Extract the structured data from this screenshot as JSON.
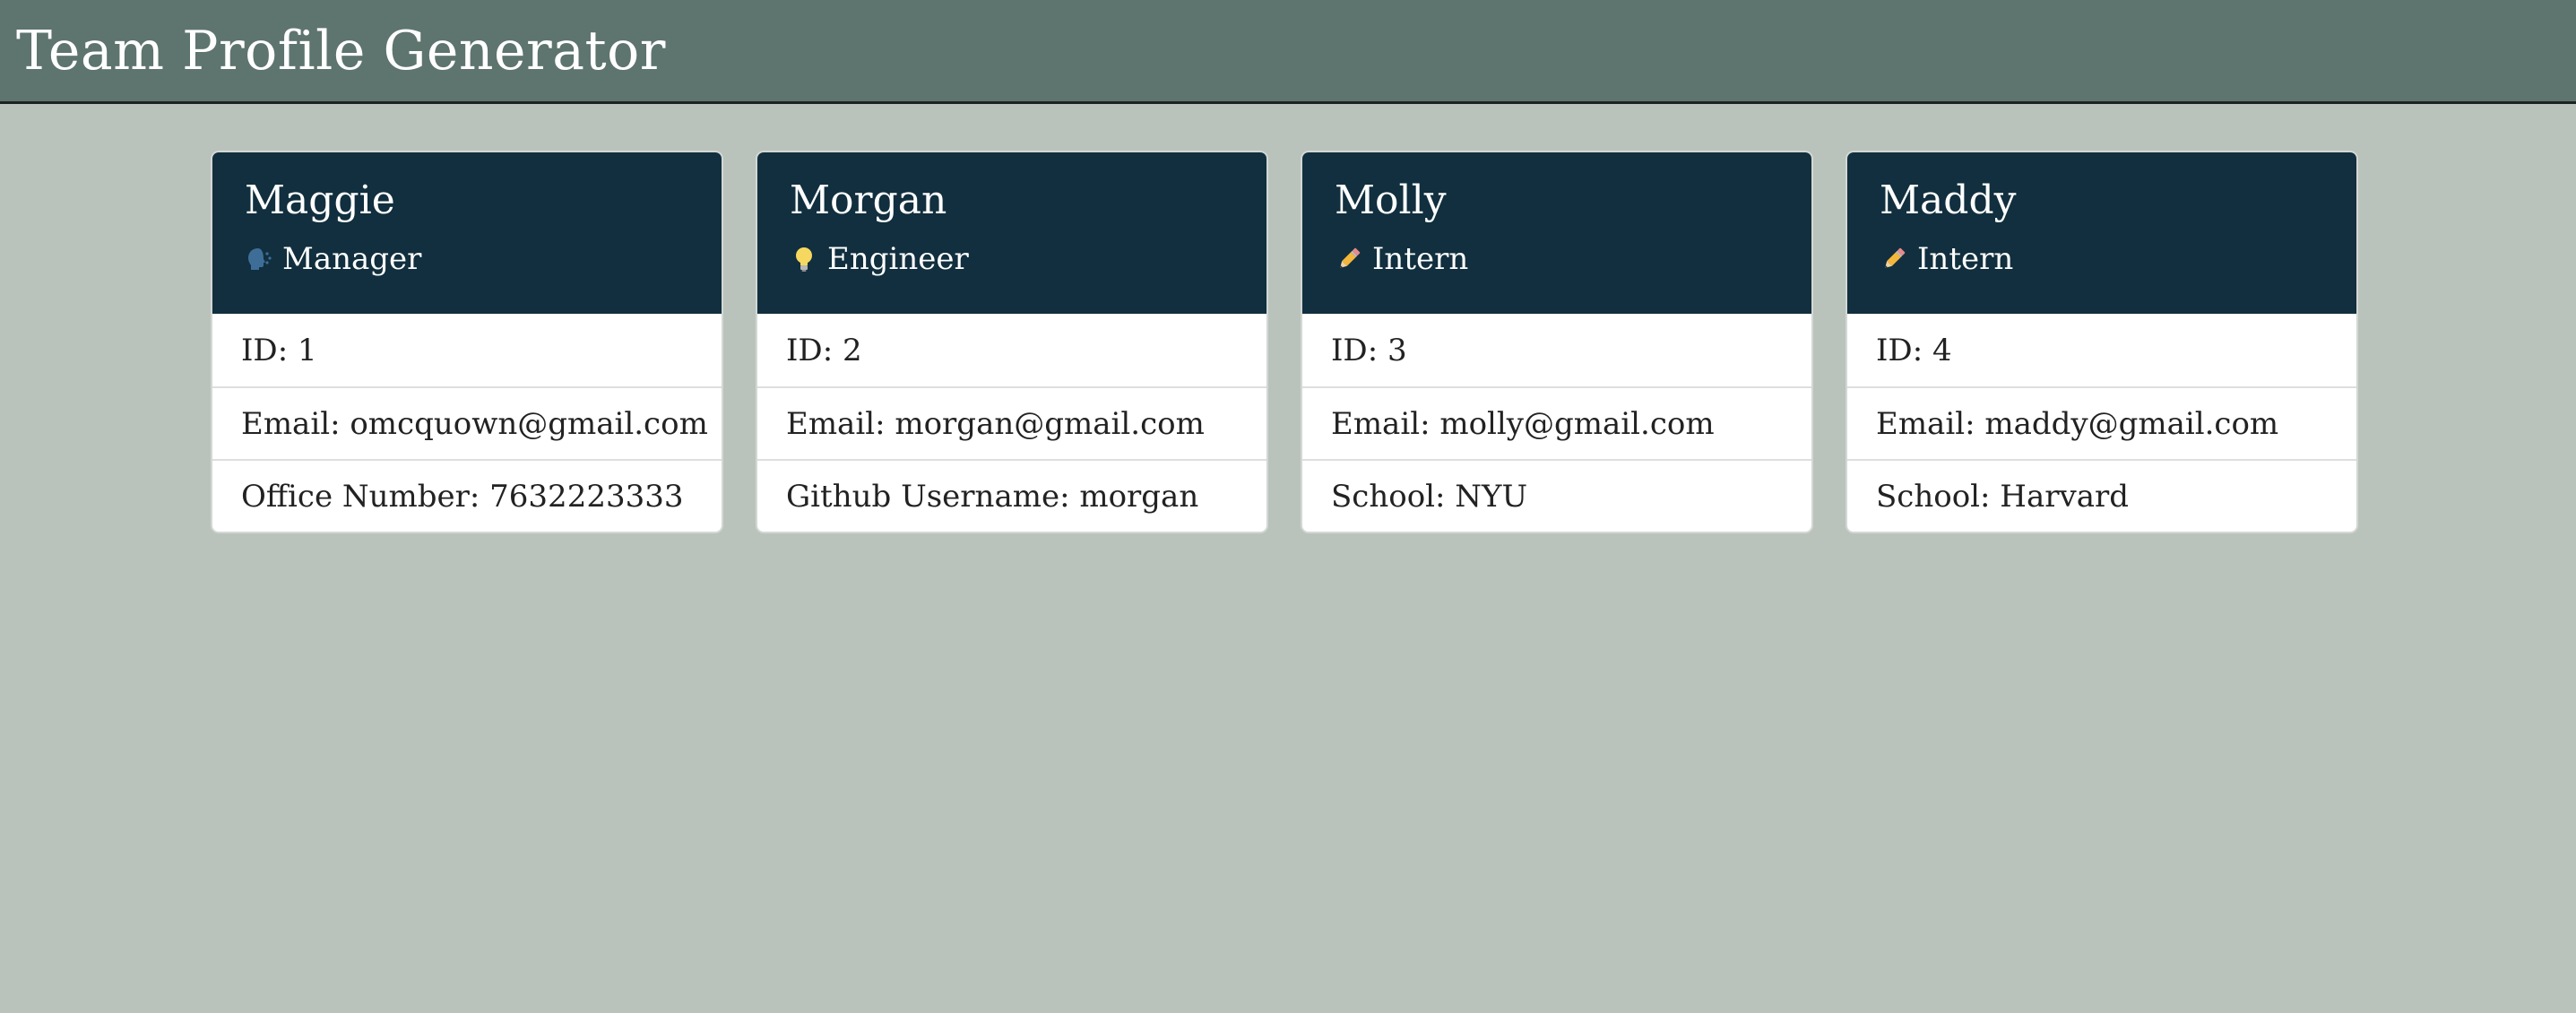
{
  "header": {
    "title": "Team Profile Generator"
  },
  "cards": [
    {
      "name": "Maggie",
      "role": "Manager",
      "role_icon": "speaking-head-icon",
      "id_text": "ID: 1",
      "email_text": "Email: omcquown@gmail.com",
      "extra_text": "Office Number: 7632223333"
    },
    {
      "name": "Morgan",
      "role": "Engineer",
      "role_icon": "lightbulb-icon",
      "id_text": "ID: 2",
      "email_text": "Email: morgan@gmail.com",
      "extra_text": "Github Username: morgan"
    },
    {
      "name": "Molly",
      "role": "Intern",
      "role_icon": "pencil-icon",
      "id_text": "ID: 3",
      "email_text": "Email: molly@gmail.com",
      "extra_text": "School: NYU"
    },
    {
      "name": "Maddy",
      "role": "Intern",
      "role_icon": "pencil-icon",
      "id_text": "ID: 4",
      "email_text": "Email: maddy@gmail.com",
      "extra_text": "School: Harvard"
    }
  ],
  "colors": {
    "page_bg": "#b9c3bb",
    "header_bg": "#5e746f",
    "card_head_bg": "#112f3e"
  }
}
